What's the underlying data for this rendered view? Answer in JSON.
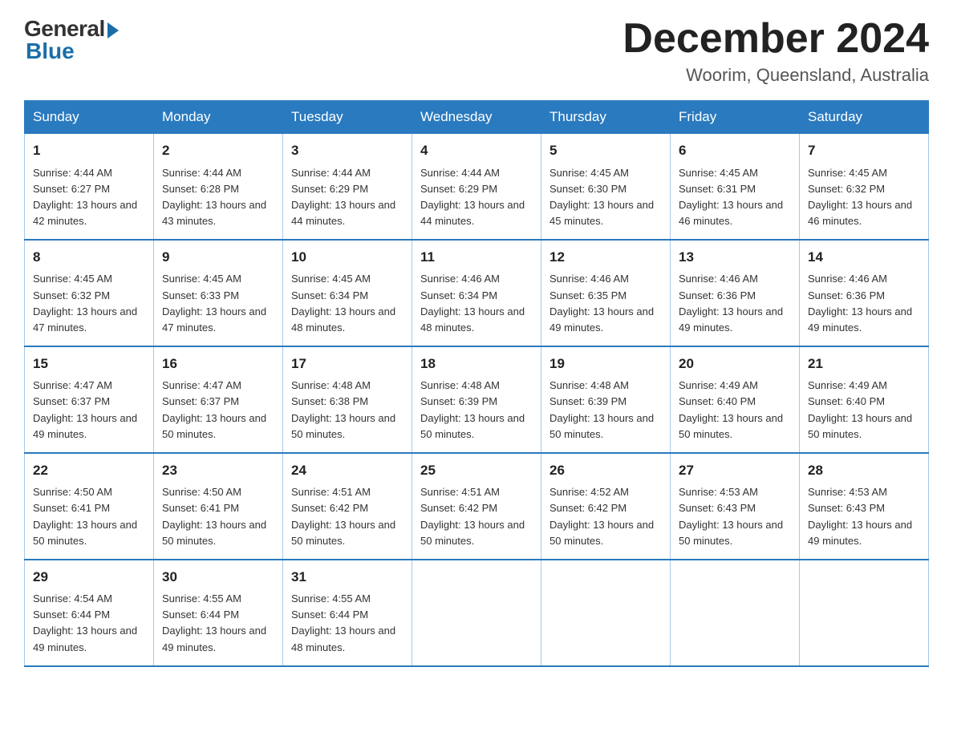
{
  "header": {
    "logo_general": "General",
    "logo_blue": "Blue",
    "month_title": "December 2024",
    "location": "Woorim, Queensland, Australia"
  },
  "days_of_week": [
    "Sunday",
    "Monday",
    "Tuesday",
    "Wednesday",
    "Thursday",
    "Friday",
    "Saturday"
  ],
  "weeks": [
    [
      {
        "day": "1",
        "sunrise": "4:44 AM",
        "sunset": "6:27 PM",
        "daylight": "13 hours and 42 minutes."
      },
      {
        "day": "2",
        "sunrise": "4:44 AM",
        "sunset": "6:28 PM",
        "daylight": "13 hours and 43 minutes."
      },
      {
        "day": "3",
        "sunrise": "4:44 AM",
        "sunset": "6:29 PM",
        "daylight": "13 hours and 44 minutes."
      },
      {
        "day": "4",
        "sunrise": "4:44 AM",
        "sunset": "6:29 PM",
        "daylight": "13 hours and 44 minutes."
      },
      {
        "day": "5",
        "sunrise": "4:45 AM",
        "sunset": "6:30 PM",
        "daylight": "13 hours and 45 minutes."
      },
      {
        "day": "6",
        "sunrise": "4:45 AM",
        "sunset": "6:31 PM",
        "daylight": "13 hours and 46 minutes."
      },
      {
        "day": "7",
        "sunrise": "4:45 AM",
        "sunset": "6:32 PM",
        "daylight": "13 hours and 46 minutes."
      }
    ],
    [
      {
        "day": "8",
        "sunrise": "4:45 AM",
        "sunset": "6:32 PM",
        "daylight": "13 hours and 47 minutes."
      },
      {
        "day": "9",
        "sunrise": "4:45 AM",
        "sunset": "6:33 PM",
        "daylight": "13 hours and 47 minutes."
      },
      {
        "day": "10",
        "sunrise": "4:45 AM",
        "sunset": "6:34 PM",
        "daylight": "13 hours and 48 minutes."
      },
      {
        "day": "11",
        "sunrise": "4:46 AM",
        "sunset": "6:34 PM",
        "daylight": "13 hours and 48 minutes."
      },
      {
        "day": "12",
        "sunrise": "4:46 AM",
        "sunset": "6:35 PM",
        "daylight": "13 hours and 49 minutes."
      },
      {
        "day": "13",
        "sunrise": "4:46 AM",
        "sunset": "6:36 PM",
        "daylight": "13 hours and 49 minutes."
      },
      {
        "day": "14",
        "sunrise": "4:46 AM",
        "sunset": "6:36 PM",
        "daylight": "13 hours and 49 minutes."
      }
    ],
    [
      {
        "day": "15",
        "sunrise": "4:47 AM",
        "sunset": "6:37 PM",
        "daylight": "13 hours and 49 minutes."
      },
      {
        "day": "16",
        "sunrise": "4:47 AM",
        "sunset": "6:37 PM",
        "daylight": "13 hours and 50 minutes."
      },
      {
        "day": "17",
        "sunrise": "4:48 AM",
        "sunset": "6:38 PM",
        "daylight": "13 hours and 50 minutes."
      },
      {
        "day": "18",
        "sunrise": "4:48 AM",
        "sunset": "6:39 PM",
        "daylight": "13 hours and 50 minutes."
      },
      {
        "day": "19",
        "sunrise": "4:48 AM",
        "sunset": "6:39 PM",
        "daylight": "13 hours and 50 minutes."
      },
      {
        "day": "20",
        "sunrise": "4:49 AM",
        "sunset": "6:40 PM",
        "daylight": "13 hours and 50 minutes."
      },
      {
        "day": "21",
        "sunrise": "4:49 AM",
        "sunset": "6:40 PM",
        "daylight": "13 hours and 50 minutes."
      }
    ],
    [
      {
        "day": "22",
        "sunrise": "4:50 AM",
        "sunset": "6:41 PM",
        "daylight": "13 hours and 50 minutes."
      },
      {
        "day": "23",
        "sunrise": "4:50 AM",
        "sunset": "6:41 PM",
        "daylight": "13 hours and 50 minutes."
      },
      {
        "day": "24",
        "sunrise": "4:51 AM",
        "sunset": "6:42 PM",
        "daylight": "13 hours and 50 minutes."
      },
      {
        "day": "25",
        "sunrise": "4:51 AM",
        "sunset": "6:42 PM",
        "daylight": "13 hours and 50 minutes."
      },
      {
        "day": "26",
        "sunrise": "4:52 AM",
        "sunset": "6:42 PM",
        "daylight": "13 hours and 50 minutes."
      },
      {
        "day": "27",
        "sunrise": "4:53 AM",
        "sunset": "6:43 PM",
        "daylight": "13 hours and 50 minutes."
      },
      {
        "day": "28",
        "sunrise": "4:53 AM",
        "sunset": "6:43 PM",
        "daylight": "13 hours and 49 minutes."
      }
    ],
    [
      {
        "day": "29",
        "sunrise": "4:54 AM",
        "sunset": "6:44 PM",
        "daylight": "13 hours and 49 minutes."
      },
      {
        "day": "30",
        "sunrise": "4:55 AM",
        "sunset": "6:44 PM",
        "daylight": "13 hours and 49 minutes."
      },
      {
        "day": "31",
        "sunrise": "4:55 AM",
        "sunset": "6:44 PM",
        "daylight": "13 hours and 48 minutes."
      },
      null,
      null,
      null,
      null
    ]
  ],
  "labels": {
    "sunrise": "Sunrise:",
    "sunset": "Sunset:",
    "daylight": "Daylight:"
  },
  "colors": {
    "header_bg": "#2a7abf",
    "border": "#aac8e8",
    "logo_blue": "#1a6ea8"
  }
}
